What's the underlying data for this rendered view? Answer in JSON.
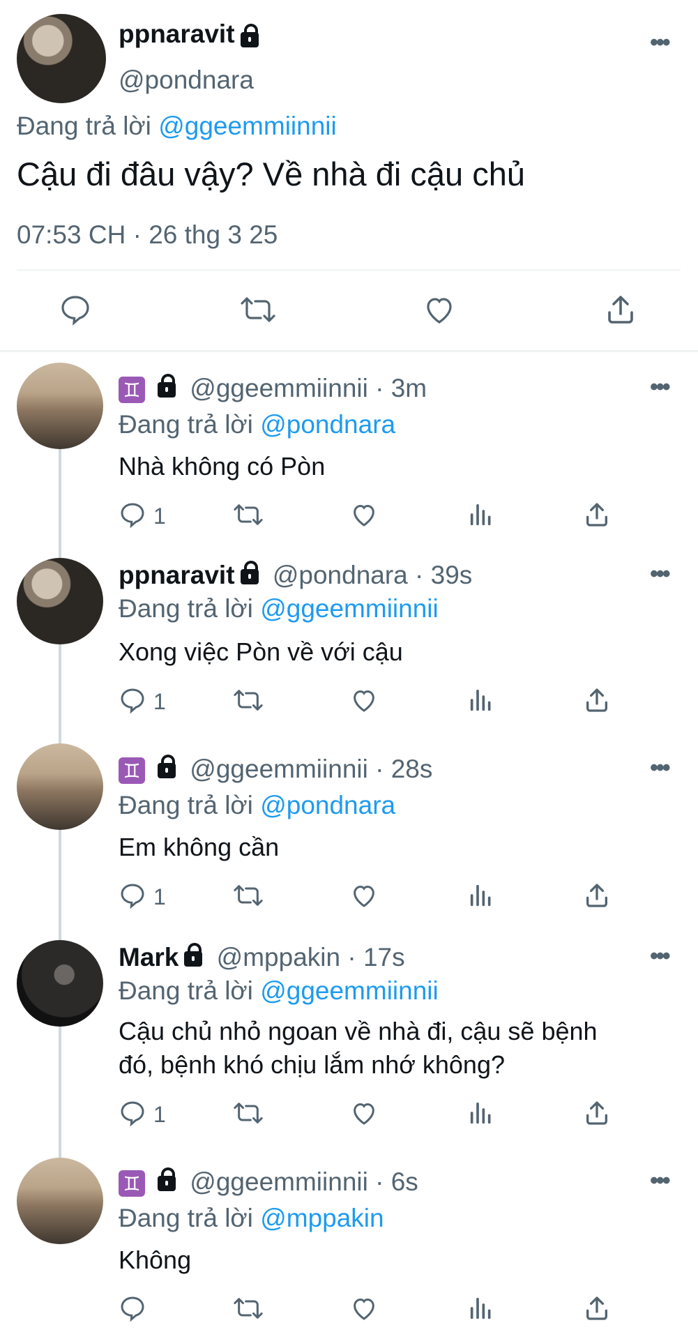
{
  "main_tweet": {
    "name": "ppnaravit",
    "handle": "@pondnara",
    "reply_prefix": "Đang trả lời",
    "reply_to": "@ggeemmiinnii",
    "text": "Cậu đi đâu vậy? Về nhà đi cậu chủ",
    "timestamp": "07:53 CH · 26 thg 3 25"
  },
  "replies": [
    {
      "gem": "♊",
      "handle": "@ggeemmiinnii",
      "time": "· 3m",
      "reply_prefix": "Đang trả lời",
      "reply_to": "@pondnara",
      "text": "Nhà không có Pòn",
      "reply_count": "1"
    },
    {
      "name": "ppnaravit",
      "handle": "@pondnara",
      "time": "· 39s",
      "reply_prefix": "Đang trả lời",
      "reply_to": "@ggeemmiinnii",
      "text": "Xong việc Pòn về với cậu",
      "reply_count": "1"
    },
    {
      "gem": "♊",
      "handle": "@ggeemmiinnii",
      "time": "· 28s",
      "reply_prefix": "Đang trả lời",
      "reply_to": "@pondnara",
      "text": "Em không cần",
      "reply_count": "1"
    },
    {
      "name": "Mark",
      "handle": "@mppakin",
      "time": "· 17s",
      "reply_prefix": "Đang trả lời",
      "reply_to": "@ggeemmiinnii",
      "text_line1": "Cậu chủ nhỏ ngoan về nhà đi, cậu sẽ bệnh",
      "text_line2": "đó, bệnh khó chịu lắm nhớ không?",
      "reply_count": "1"
    },
    {
      "gem": "♊",
      "handle": "@ggeemmiinnii",
      "time": "· 6s",
      "reply_prefix": "Đang trả lời",
      "reply_to": "@mppakin",
      "text": "Không"
    }
  ],
  "more_glyph": "•••",
  "icons": [
    "reply-icon",
    "retweet-icon",
    "like-icon",
    "share-icon",
    "views-icon",
    "lock-icon",
    "more-icon"
  ],
  "colors": {
    "link": "#1d9bf0",
    "muted": "#536471",
    "text": "#0f1419"
  }
}
